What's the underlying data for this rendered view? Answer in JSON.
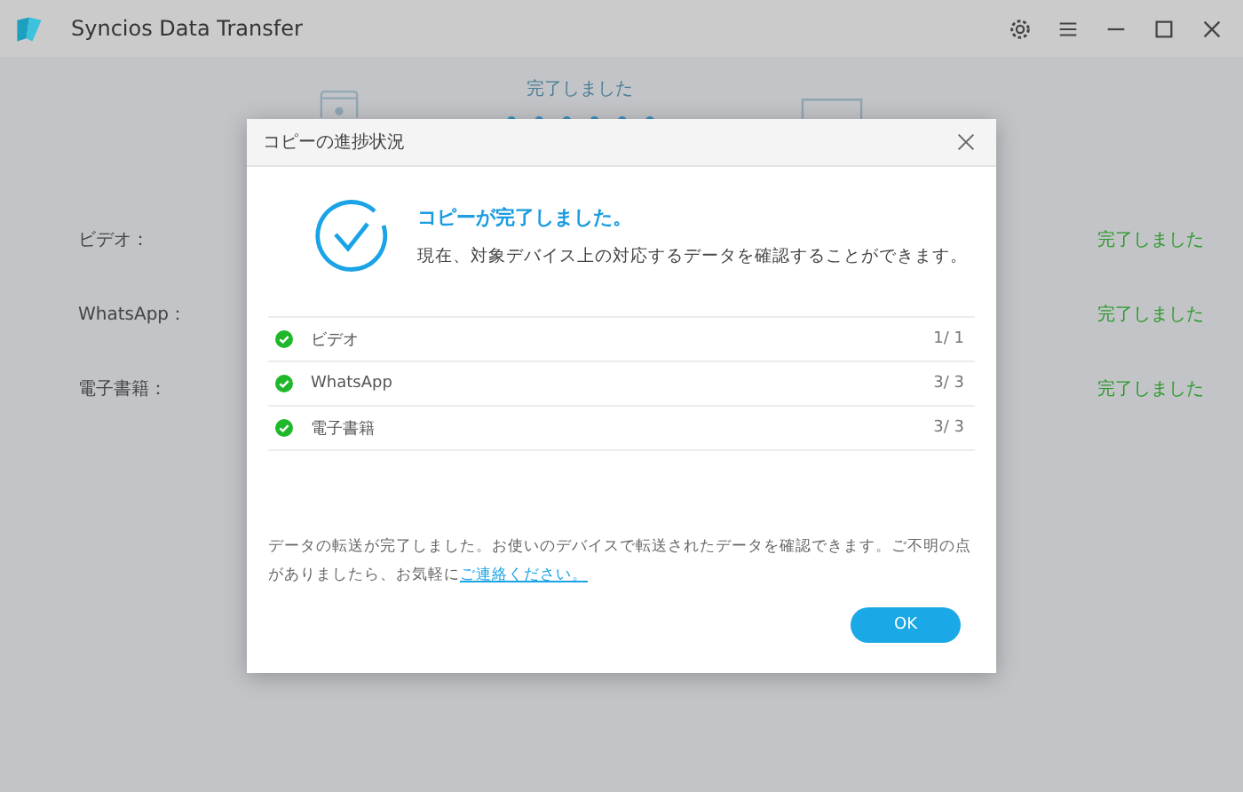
{
  "window": {
    "title": "Syncios Data Transfer"
  },
  "transfer": {
    "status": "完了しました"
  },
  "categories": [
    {
      "label": "ビデオ：",
      "status": "完了しました"
    },
    {
      "label": "WhatsApp：",
      "status": "完了しました"
    },
    {
      "label": "電子書籍：",
      "status": "完了しました"
    }
  ],
  "dialog": {
    "title": "コピーの進捗状況",
    "heading": "コピーが完了しました。",
    "subtitle": "現在、対象デバイス上の対応するデータを確認することができます。",
    "items": [
      {
        "name": "ビデオ",
        "count": "1/ 1",
        "completed": true
      },
      {
        "name": "WhatsApp",
        "count": "3/ 3",
        "completed": true
      },
      {
        "name": "電子書籍",
        "count": "3/ 3",
        "completed": true
      }
    ],
    "note": "データの転送が完了しました。お使いのデバイスで転送されたデータを確認できます。ご不明の点がありましたら、お気軽に",
    "link": "ご連絡ください。",
    "button": "OK"
  }
}
